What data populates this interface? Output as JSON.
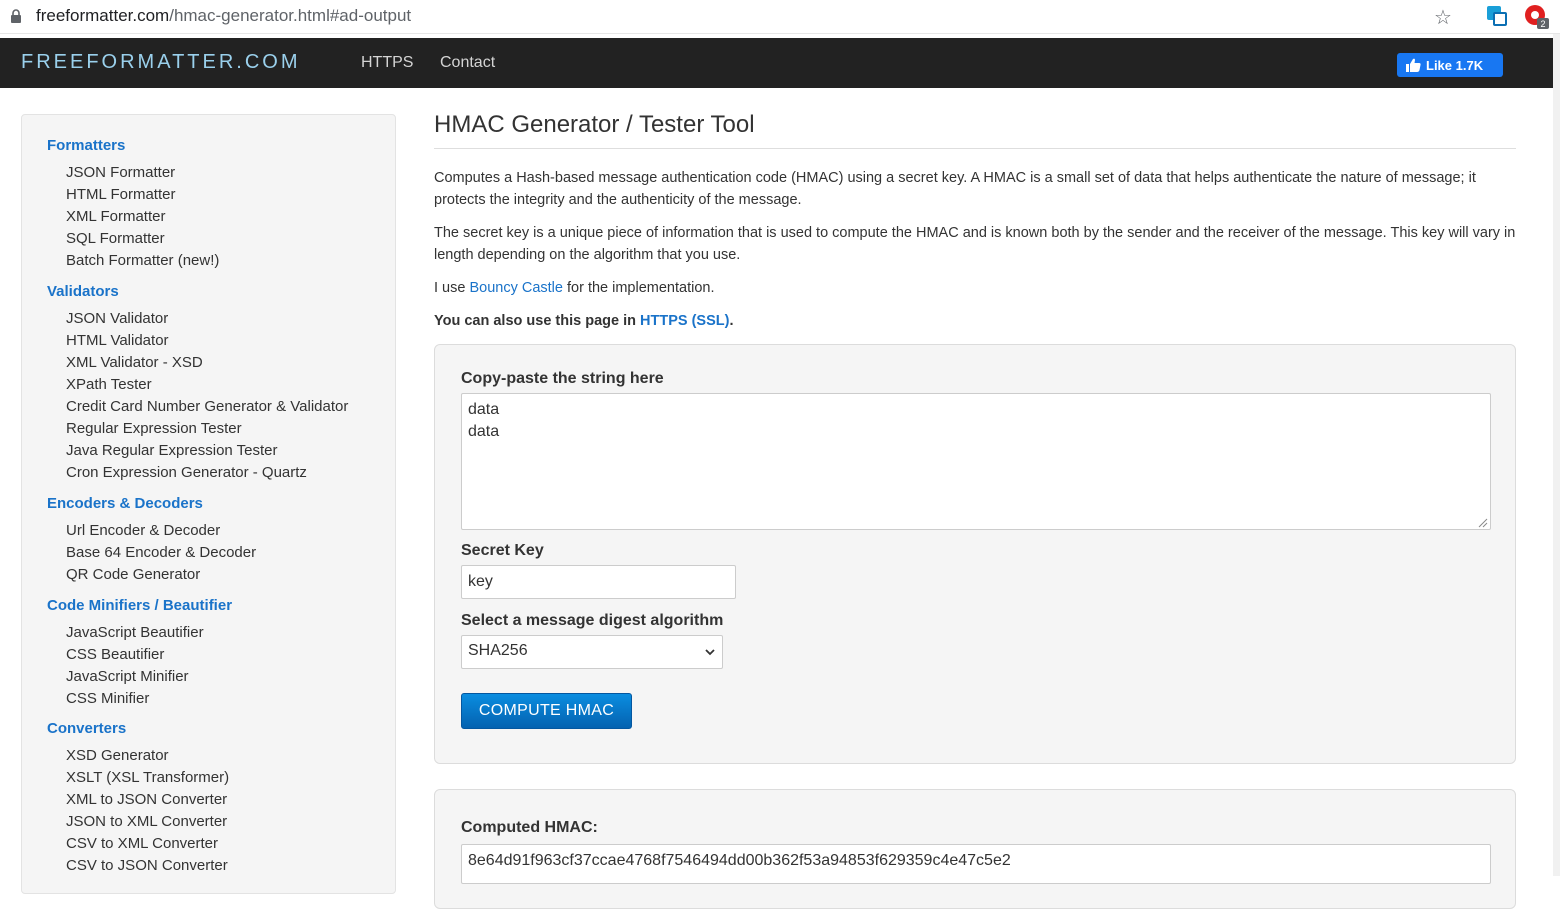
{
  "browser": {
    "url_host": "freeformatter.com",
    "url_path": "/hmac-generator.html#ad-output",
    "ext_badge": "2"
  },
  "nav": {
    "brand": "FREEFORMATTER.COM",
    "links": [
      "HTTPS",
      "Contact"
    ],
    "like_label": "Like 1.7K"
  },
  "sidebar": {
    "sections": [
      {
        "title": "Formatters",
        "items": [
          "JSON Formatter",
          "HTML Formatter",
          "XML Formatter",
          "SQL Formatter",
          "Batch Formatter (new!)"
        ]
      },
      {
        "title": "Validators",
        "items": [
          "JSON Validator",
          "HTML Validator",
          "XML Validator - XSD",
          "XPath Tester",
          "Credit Card Number Generator & Validator",
          "Regular Expression Tester",
          "Java Regular Expression Tester",
          "Cron Expression Generator - Quartz"
        ]
      },
      {
        "title": "Encoders & Decoders",
        "items": [
          "Url Encoder & Decoder",
          "Base 64 Encoder & Decoder",
          "QR Code Generator"
        ]
      },
      {
        "title": "Code Minifiers / Beautifier",
        "items": [
          "JavaScript Beautifier",
          "CSS Beautifier",
          "JavaScript Minifier",
          "CSS Minifier"
        ]
      },
      {
        "title": "Converters",
        "items": [
          "XSD Generator",
          "XSLT (XSL Transformer)",
          "XML to JSON Converter",
          "JSON to XML Converter",
          "CSV to XML Converter",
          "CSV to JSON Converter"
        ]
      }
    ]
  },
  "main": {
    "title": "HMAC Generator / Tester Tool",
    "para1": "Computes a Hash-based message authentication code (HMAC) using a secret key. A HMAC is a small set of data that helps authenticate the nature of message; it protects the integrity and the authenticity of the message.",
    "para2": "The secret key is a unique piece of information that is used to compute the HMAC and is known both by the sender and the receiver of the message. This key will vary in length depending on the algorithm that you use.",
    "para3_prefix": "I use ",
    "para3_link": "Bouncy Castle",
    "para3_suffix": " for the implementation.",
    "para4_prefix": "You can also use this page in ",
    "para4_link": "HTTPS (SSL)",
    "para4_suffix": ".",
    "form": {
      "string_label": "Copy-paste the string here",
      "string_value": "data\ndata",
      "key_label": "Secret Key",
      "key_value": "key",
      "algo_label": "Select a message digest algorithm",
      "algo_value": "SHA256",
      "compute_label": "COMPUTE HMAC"
    },
    "result": {
      "label": "Computed HMAC:",
      "value": "8e64d91f963cf37ccae4768f7546494dd00b362f53a94853f629359c4e47c5e2"
    }
  }
}
